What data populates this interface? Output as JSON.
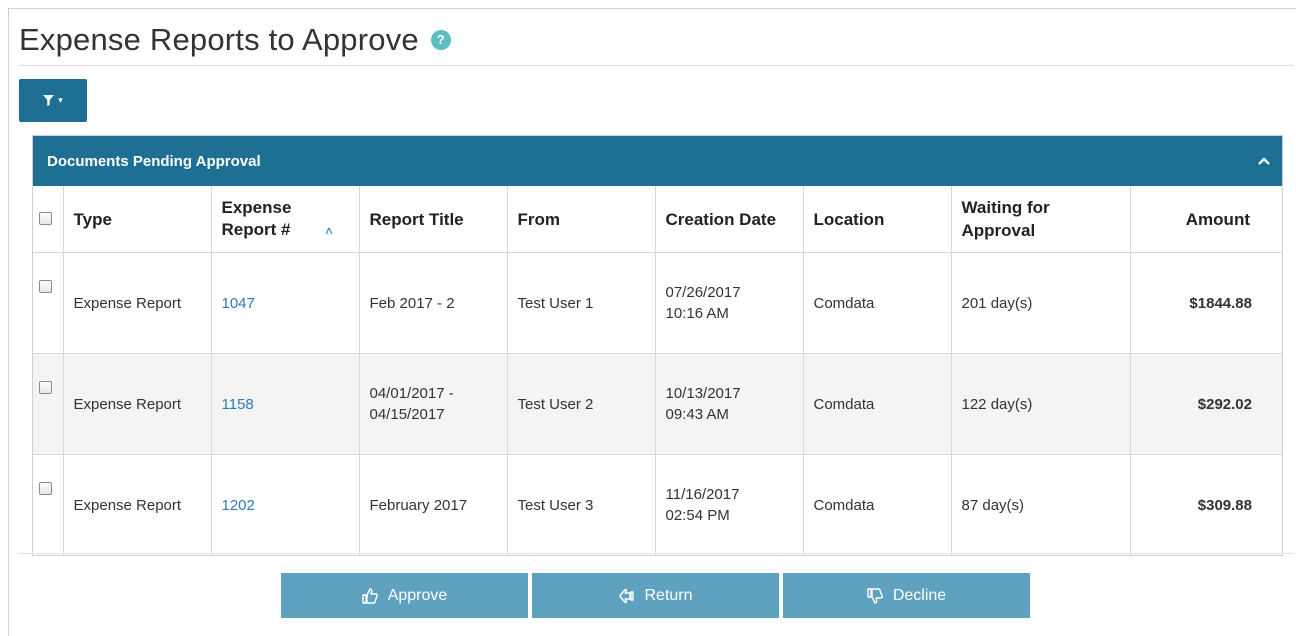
{
  "page": {
    "title": "Expense Reports to Approve",
    "help_icon": "?"
  },
  "filter_button": {
    "icon": "filter-icon",
    "caret": "▾"
  },
  "panel": {
    "title": "Documents Pending Approval",
    "collapse_icon": "chevron-up-icon",
    "columns": [
      "Type",
      "Expense Report #",
      "Report Title",
      "From",
      "Creation Date",
      "Location",
      "Waiting for Approval",
      "Amount"
    ],
    "sorted_column": "Expense Report #",
    "rows": [
      {
        "type": "Expense Report",
        "report_no": "1047",
        "title": "Feb 2017 - 2",
        "title_line2": "",
        "from": "Test User 1",
        "date": "07/26/2017",
        "time": "10:16 AM",
        "location": "Comdata",
        "waiting": "201 day(s)",
        "amount": "$1844.88"
      },
      {
        "type": "Expense Report",
        "report_no": "1158",
        "title": "04/01/2017 -",
        "title_line2": "04/15/2017",
        "from": "Test User 2",
        "date": "10/13/2017",
        "time": "09:43 AM",
        "location": "Comdata",
        "waiting": "122 day(s)",
        "amount": "$292.02"
      },
      {
        "type": "Expense Report",
        "report_no": "1202",
        "title": "February 2017",
        "title_line2": "",
        "from": "Test User 3",
        "date": "11/16/2017",
        "time": "02:54 PM",
        "location": "Comdata",
        "waiting": "87 day(s)",
        "amount": "$309.88"
      }
    ]
  },
  "actions": {
    "approve": {
      "label": "Approve",
      "icon": "thumbs-up-icon"
    },
    "return": {
      "label": "Return",
      "icon": "return-hand-icon"
    },
    "decline": {
      "label": "Decline",
      "icon": "thumbs-down-icon"
    }
  },
  "colors": {
    "header_blue": "#1e6f94",
    "action_blue": "#5ea2bf",
    "link_blue": "#2b7bb9",
    "help_teal": "#5bbfbf"
  }
}
